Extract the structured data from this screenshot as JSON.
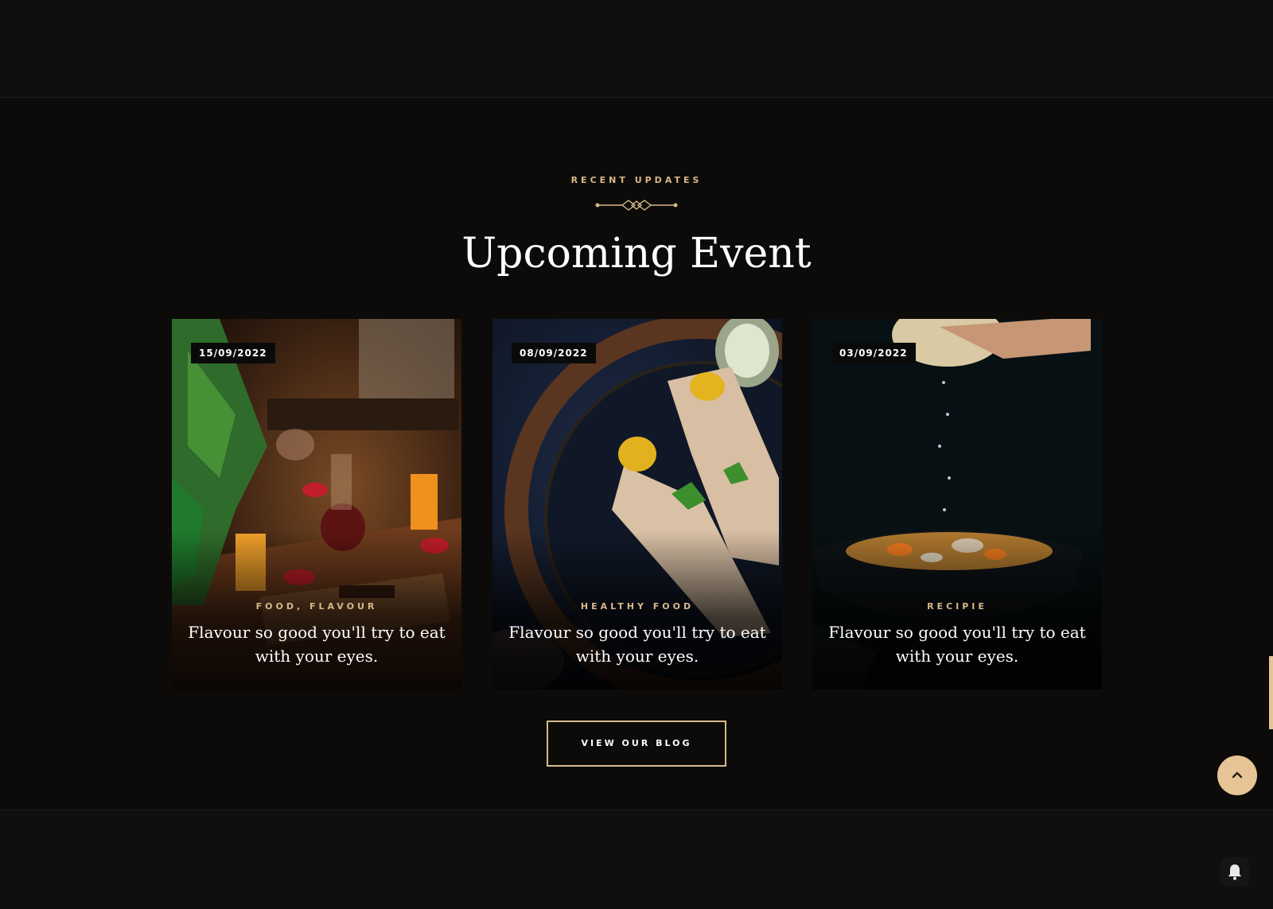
{
  "section": {
    "eyebrow": "RECENT UPDATES",
    "title": "Upcoming Event"
  },
  "cards": [
    {
      "date": "15/09/2022",
      "category": "FOOD, FLAVOUR",
      "title": "Flavour so good you'll try to eat with your eyes.",
      "image": "restaurant-table-spread-photo"
    },
    {
      "date": "08/09/2022",
      "category": "HEALTHY FOOD",
      "title": "Flavour so good you'll try to eat with your eyes.",
      "image": "stuffed-wraps-plate-photo"
    },
    {
      "date": "03/09/2022",
      "category": "RECIPIE",
      "title": "Flavour so good you'll try to eat with your eyes.",
      "image": "soup-bowl-lemon-photo"
    }
  ],
  "actions": {
    "blog_button": "VIEW OUR BLOG"
  },
  "icons": {
    "scroll_top": "chevron-up-icon",
    "notifications": "bell-icon"
  },
  "colors": {
    "background": "#0c0b09",
    "accent": "#d7b88a",
    "accent_button": "#e6c495",
    "text": "#ffffff"
  }
}
